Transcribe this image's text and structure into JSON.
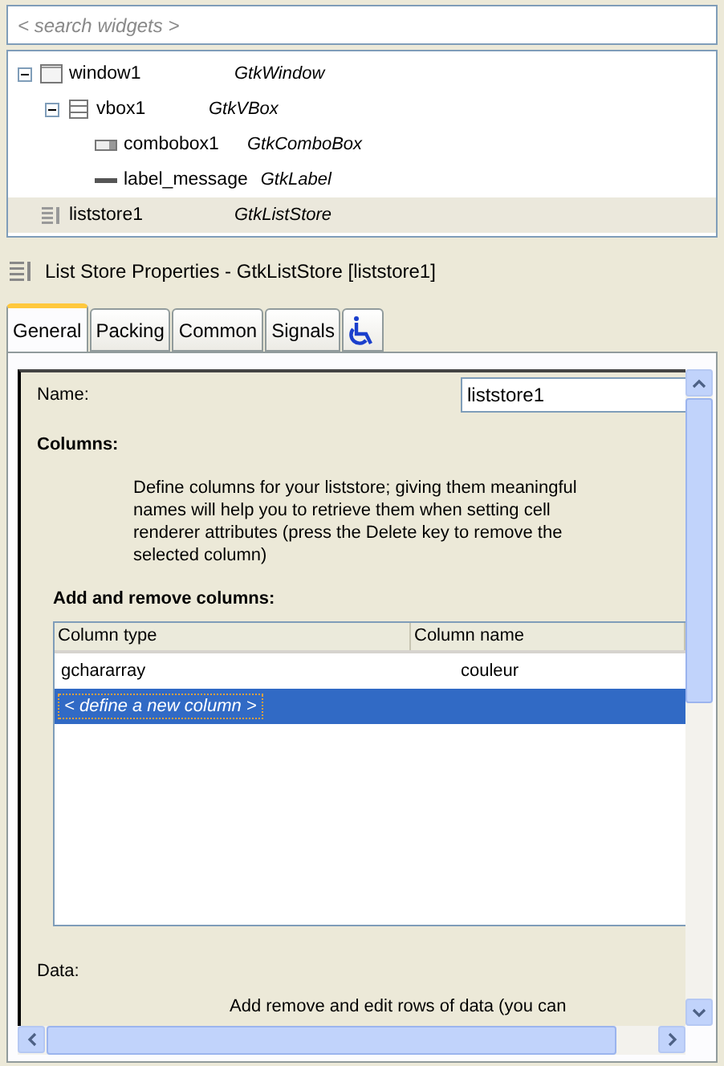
{
  "search": {
    "placeholder": "< search widgets >"
  },
  "tree": [
    {
      "name": "window1",
      "type": "GtkWindow",
      "kind": "window",
      "expanded": true,
      "selected": false,
      "children": [
        {
          "name": "vbox1",
          "type": "GtkVBox",
          "kind": "vbox",
          "expanded": true,
          "selected": false,
          "children": [
            {
              "name": "combobox1",
              "type": "GtkComboBox",
              "kind": "combo",
              "selected": false
            },
            {
              "name": "label_message",
              "type": "GtkLabel",
              "kind": "label",
              "selected": false
            }
          ]
        }
      ]
    },
    {
      "name": "liststore1",
      "type": "GtkListStore",
      "kind": "list",
      "selected": true
    }
  ],
  "properties_title": "List Store Properties - GtkListStore [liststore1]",
  "tabs": [
    {
      "label": "General",
      "selected": true,
      "kind": "text"
    },
    {
      "label": "Packing",
      "selected": false,
      "kind": "text"
    },
    {
      "label": "Common",
      "selected": false,
      "kind": "text"
    },
    {
      "label": "Signals",
      "selected": false,
      "kind": "text"
    },
    {
      "selected": false,
      "kind": "accessibility"
    }
  ],
  "name_label": "Name:",
  "name_value": "liststore1",
  "columns_heading": "Columns:",
  "columns_description": "Define columns for your liststore; giving them meaningful names will help you to retrieve them when setting cell renderer attributes (press the Delete key to remove the selected column)",
  "add_remove_heading": "Add and remove columns:",
  "table": {
    "columns": [
      "Column type",
      "Column name"
    ],
    "rows": [
      {
        "cells": [
          "gchararray",
          "couleur"
        ],
        "selected": false,
        "kind": "normal"
      },
      {
        "cells": [
          "< define a new column >"
        ],
        "selected": true,
        "kind": "placeholder"
      }
    ]
  },
  "data_label": "Data:",
  "data_description": "Add remove and edit rows of data (you can"
}
